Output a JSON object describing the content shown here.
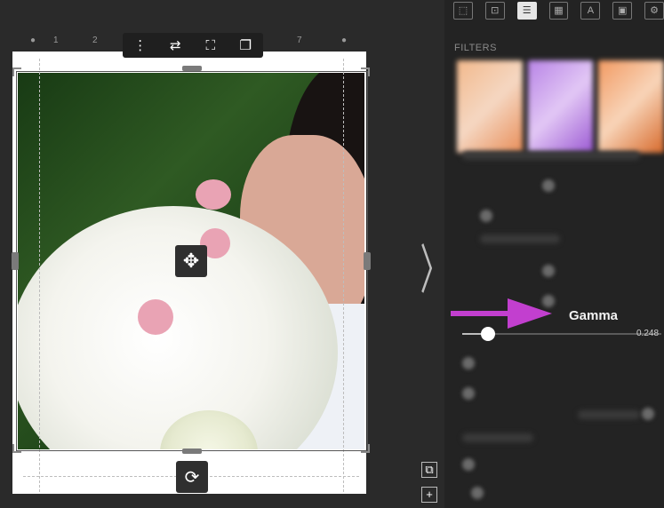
{
  "ruler": {
    "ticks": [
      "1",
      "2",
      "7"
    ]
  },
  "toolbar": {
    "more_icon": "⋮",
    "swap_icon": "⇄",
    "fit_icon": "⛶",
    "bookmark_icon": "❐"
  },
  "canvas": {
    "move_icon": "✥",
    "rotate_icon": "⟳",
    "next_page_icon": "〉",
    "add_page_icon": "+",
    "copy_page_icon": "⧉"
  },
  "panel": {
    "section_title": "FILTERS",
    "tabs": [
      "⬚",
      "⊡",
      "☰",
      "▦",
      "A",
      "▣",
      "⚙"
    ],
    "active_tab": 2,
    "adjustment": {
      "label": "Gamma",
      "value": "0.248",
      "slider_fraction": 0.13
    }
  },
  "colors": {
    "annotation_arrow": "#c23fcf",
    "panel_bg": "#232323",
    "canvas_bg": "#2a2a2a"
  }
}
